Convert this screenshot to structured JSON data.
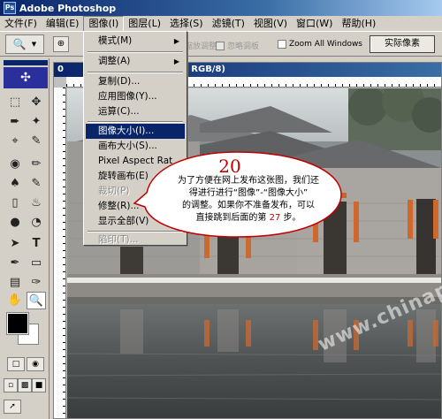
{
  "app": {
    "title": "Adobe Photoshop",
    "icon": "photoshop-icon"
  },
  "menubar": {
    "items": [
      "文件(F)",
      "编辑(E)",
      "图像(I)",
      "图层(L)",
      "选择(S)",
      "滤镜(T)",
      "视图(V)",
      "窗口(W)",
      "帮助(H)"
    ],
    "active": "图像(I)"
  },
  "options": {
    "zoom_tool_icon": "magnifier-icon",
    "resize_windows_label": "缩放调整",
    "ignore_palettes_label": "忽略调板",
    "zoom_all_windows_label": "Zoom All Windows",
    "actual_pixels_label": "实际像素"
  },
  "document": {
    "title_left": "0",
    "title_right": ", RGB/8)"
  },
  "image_menu": {
    "items": [
      {
        "label": "模式(M)",
        "submenu": true
      },
      {
        "label": "调整(A)",
        "submenu": true
      },
      {
        "label": "复制(D)...",
        "submenu": false
      },
      {
        "label": "应用图像(Y)...",
        "submenu": false
      },
      {
        "label": "运算(C)...",
        "submenu": false
      },
      {
        "label": "图像大小(I)...",
        "highlighted": true
      },
      {
        "label": "画布大小(S)..."
      },
      {
        "label": "Pixel Aspect Rat"
      },
      {
        "label": "旋转画布(E)"
      },
      {
        "label": "裁切(P)",
        "disabled": true
      },
      {
        "label": "修整(R)..."
      },
      {
        "label": "显示全部(V)"
      },
      {
        "label": "陷印(T)...",
        "disabled": true
      }
    ]
  },
  "callout": {
    "step_number": "20",
    "text_line1": "为了方便在网上发布这张图，我们还",
    "text_line2": "得进行进行“图像”-“图像大小”",
    "text_line3": "的调整。如果你不准备发布，可以",
    "text_line4_a": "直接跳到后面的第",
    "text_line4_step": "27",
    "text_line4_b": "步。"
  },
  "watermark": "www.chinaps.net",
  "colors": {
    "title_bar": "#0a246a",
    "menu_highlight": "#0a246a",
    "callout_number": "#c00000"
  }
}
